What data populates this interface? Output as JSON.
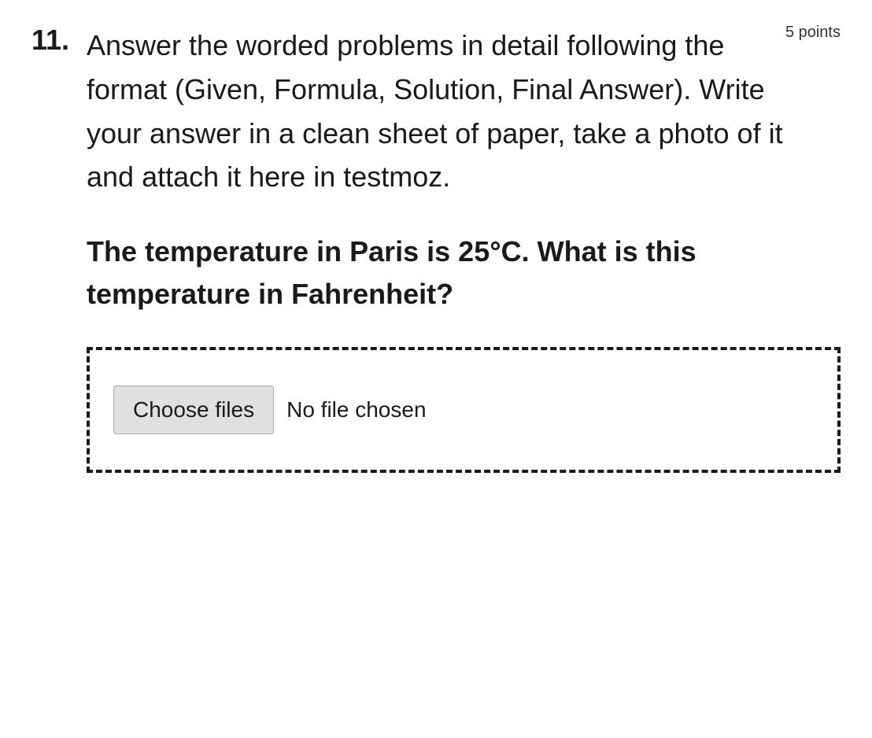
{
  "question": {
    "number": "11.",
    "points": "5 points",
    "instruction": "Answer the worded problems in detail following the format (Given, Formula, Solution, Final Answer). Write your answer in a clean sheet of paper, take a photo of it and attach it here in testmoz.",
    "problem": "The temperature in Paris is 25°C. What is this temperature in Fahrenheit?",
    "upload": {
      "choose_files_label": "Choose files",
      "no_file_label": "No file chosen"
    }
  }
}
